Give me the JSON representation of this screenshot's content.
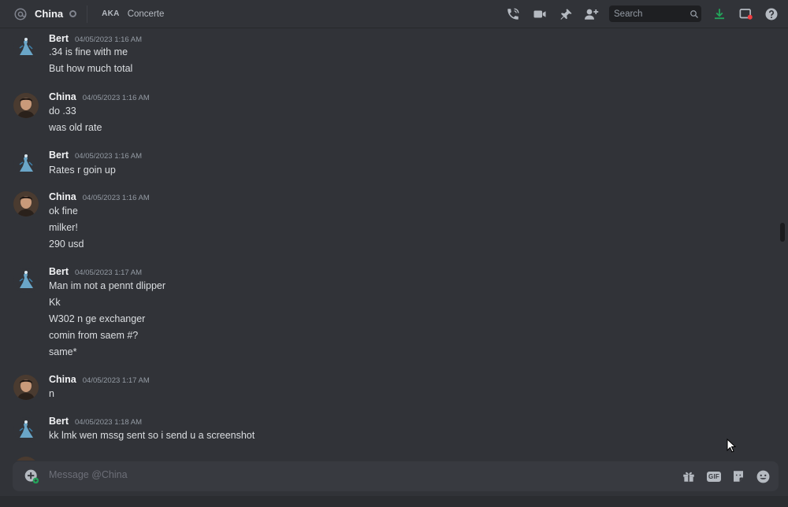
{
  "header": {
    "channel_name": "China",
    "aka_label": "AKA",
    "aka_name": "Concerte",
    "search_placeholder": "Search"
  },
  "icons": [
    "at-icon",
    "status-icon",
    "call-icon",
    "video-icon",
    "pin-icon",
    "add-friend-icon",
    "search-icon",
    "download-icon",
    "inbox-icon",
    "help-icon",
    "add-attachment-icon",
    "gift-icon",
    "gif-icon",
    "sticker-icon",
    "emoji-icon"
  ],
  "colors": {
    "background": "#313338",
    "download_accent": "#23a55a",
    "notification_red": "#f23f43"
  },
  "messages": [
    {
      "author": "Bert",
      "timestamp": "04/05/2023 1:16 AM",
      "lines": [
        ".34 is fine with me",
        "But how much total"
      ]
    },
    {
      "author": "China",
      "timestamp": "04/05/2023 1:16 AM",
      "lines": [
        "do .33",
        "was old rate"
      ]
    },
    {
      "author": "Bert",
      "timestamp": "04/05/2023 1:16 AM",
      "lines": [
        "Rates r goin up"
      ]
    },
    {
      "author": "China",
      "timestamp": "04/05/2023 1:16 AM",
      "lines": [
        "ok fine",
        "milker!",
        "290 usd"
      ]
    },
    {
      "author": "Bert",
      "timestamp": "04/05/2023 1:17 AM",
      "lines": [
        "Man im not a pennt dlipper",
        "Kk",
        "W302 n ge exchanger",
        "comin from saem #?",
        "same*"
      ]
    },
    {
      "author": "China",
      "timestamp": "04/05/2023 1:17 AM",
      "lines": [
        "n"
      ]
    },
    {
      "author": "Bert",
      "timestamp": "04/05/2023 1:18 AM",
      "lines": [
        "kk lmk wen mssg sent so i send u a screenshot"
      ]
    }
  ],
  "composer": {
    "placeholder": "Message @China",
    "gif_label": "GIF"
  }
}
